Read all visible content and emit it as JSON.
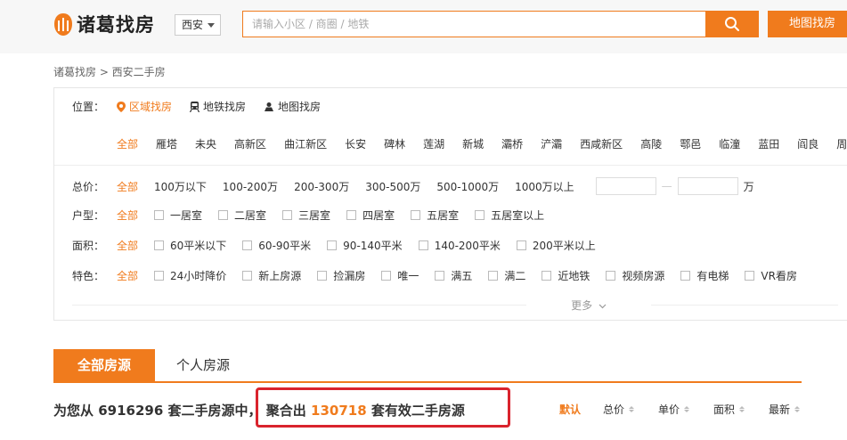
{
  "header": {
    "logo_text": "诸葛找房",
    "city": "西安",
    "search_placeholder": "请输入小区 / 商圈 / 地铁",
    "map_button": "地图找房"
  },
  "breadcrumb": "诸葛找房 > 西安二手房",
  "location": {
    "label": "位置：",
    "tabs": [
      "区域找房",
      "地铁找房",
      "地图找房"
    ],
    "districts": [
      "全部",
      "雁塔",
      "未央",
      "高新区",
      "曲江新区",
      "长安",
      "碑林",
      "莲湖",
      "新城",
      "灞桥",
      "浐灞",
      "西咸新区",
      "高陵",
      "鄠邑",
      "临潼",
      "蓝田",
      "阎良",
      "周"
    ]
  },
  "filters": {
    "price": {
      "label": "总价：",
      "all": "全部",
      "options": [
        "100万以下",
        "100-200万",
        "200-300万",
        "300-500万",
        "500-1000万",
        "1000万以上"
      ],
      "dash": "—",
      "unit": "万"
    },
    "type": {
      "label": "户型：",
      "all": "全部",
      "options": [
        "一居室",
        "二居室",
        "三居室",
        "四居室",
        "五居室",
        "五居室以上"
      ]
    },
    "area": {
      "label": "面积：",
      "all": "全部",
      "options": [
        "60平米以下",
        "60-90平米",
        "90-140平米",
        "140-200平米",
        "200平米以上"
      ]
    },
    "feature": {
      "label": "特色：",
      "all": "全部",
      "options": [
        "24小时降价",
        "新上房源",
        "捡漏房",
        "唯一",
        "满五",
        "满二",
        "近地铁",
        "视频房源",
        "有电梯",
        "VR看房"
      ]
    },
    "more": "更多"
  },
  "tabs": [
    "全部房源",
    "个人房源"
  ],
  "result": {
    "prefix": "为您从",
    "total": "6916296",
    "mid": "套二手房源中，",
    "agg": "聚合出",
    "valid": "130718",
    "suffix": "套有效二手房源"
  },
  "sort": [
    "默认",
    "总价",
    "单价",
    "面积",
    "最新"
  ],
  "colors": {
    "accent": "#f07b1d",
    "highlight_box": "#d9232d"
  }
}
